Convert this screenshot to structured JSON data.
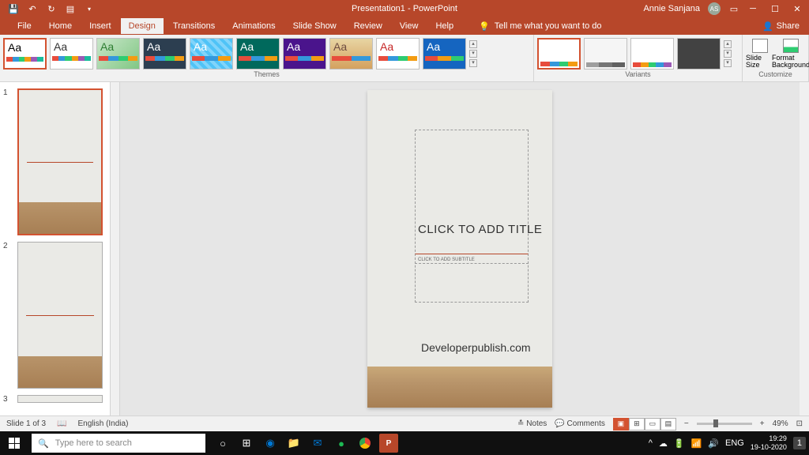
{
  "titlebar": {
    "title": "Presentation1 - PowerPoint",
    "user_name": "Annie Sanjana",
    "user_initials": "AS"
  },
  "ribbon_tabs": {
    "file": "File",
    "home": "Home",
    "insert": "Insert",
    "design": "Design",
    "transitions": "Transitions",
    "animations": "Animations",
    "slideshow": "Slide Show",
    "review": "Review",
    "view": "View",
    "help": "Help",
    "tell_me": "Tell me what you want to do",
    "share": "Share"
  },
  "ribbon": {
    "themes_label": "Themes",
    "variants_label": "Variants",
    "customize_label": "Customize",
    "slide_size": "Slide Size",
    "format_bg": "Format Background",
    "theme_aa": "Aa"
  },
  "slide": {
    "title_placeholder": "CLICK TO ADD TITLE",
    "subtitle_placeholder": "CLICK TO ADD SUBTITLE",
    "watermark": "Developerpublish.com"
  },
  "thumbnails": {
    "n1": "1",
    "n2": "2",
    "n3": "3"
  },
  "statusbar": {
    "slide_info": "Slide 1 of 3",
    "language": "English (India)",
    "notes": "Notes",
    "comments": "Comments",
    "zoom": "49%"
  },
  "taskbar": {
    "search_placeholder": "Type here to search",
    "lang": "ENG",
    "time": "19:29",
    "date": "19-10-2020",
    "notif_count": "1"
  }
}
